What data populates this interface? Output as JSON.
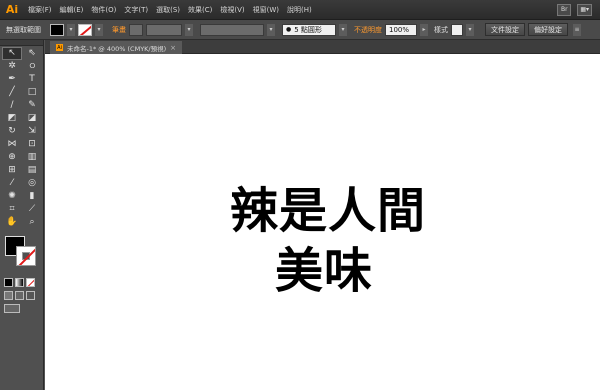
{
  "app": {
    "logo": "Ai"
  },
  "menu": {
    "items": [
      "檔案(F)",
      "編輯(E)",
      "物件(O)",
      "文字(T)",
      "選取(S)",
      "效果(C)",
      "檢視(V)",
      "視窗(W)",
      "說明(H)"
    ],
    "br_label": "Br"
  },
  "control": {
    "selection_label": "無選取範圍",
    "stroke_label": "筆畫",
    "brush_value": "5 點圓形",
    "opacity_label": "不透明度",
    "opacity_value": "100%",
    "style_label": "樣式",
    "doc_settings_button": "文件設定",
    "prefs_button": "偏好設定"
  },
  "document": {
    "tab_title": "未命名-1* @ 400% (CMYK/預視)",
    "tab_icon": "Ai",
    "close_glyph": "×",
    "artwork_line1": "辣是人間",
    "artwork_line2": "美味"
  },
  "colors": {
    "accent": "#ff9a00",
    "stroke_label": "#ff9a2e",
    "fill": "#000000",
    "none_slash": "#e21a1a"
  },
  "tools": [
    "selection-tool-icon",
    "direct-selection-tool-icon",
    "magic-wand-icon",
    "lasso-icon",
    "pen-tool-icon",
    "type-tool-icon",
    "line-segment-icon",
    "rectangle-tool-icon",
    "paintbrush-icon",
    "pencil-icon",
    "blob-brush-icon",
    "eraser-icon",
    "rotate-tool-icon",
    "scale-tool-icon",
    "width-tool-icon",
    "free-transform-icon",
    "shape-builder-icon",
    "perspective-grid-icon",
    "mesh-tool-icon",
    "gradient-tool-icon",
    "eyedropper-icon",
    "blend-tool-icon",
    "symbol-sprayer-icon",
    "column-graph-icon",
    "artboard-tool-icon",
    "slice-tool-icon",
    "hand-tool-icon",
    "zoom-tool-icon"
  ]
}
